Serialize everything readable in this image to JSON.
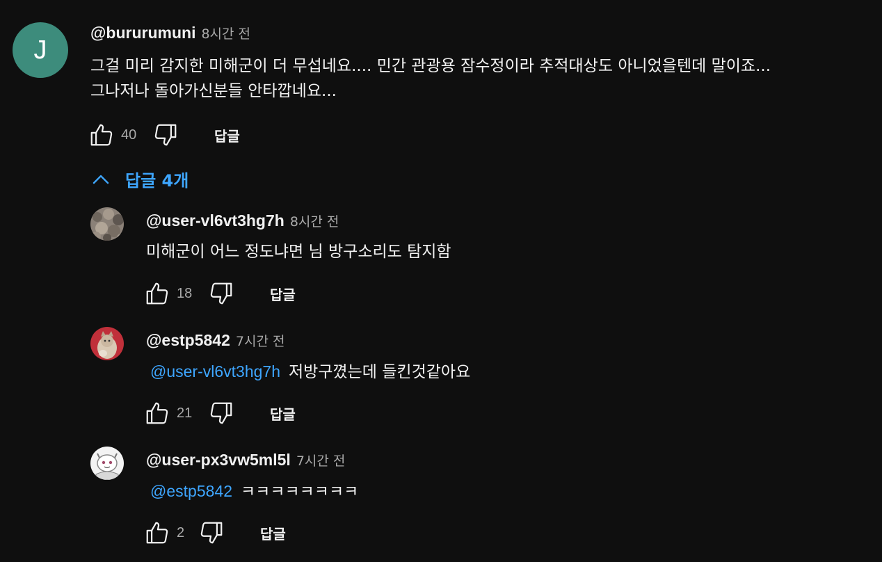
{
  "top_comment": {
    "avatar_letter": "J",
    "avatar_color": "#3d8c7c",
    "handle": "@bururumuni",
    "time": "8시간 전",
    "text_line1": "그걸 미리 감지한 미해군이 더 무섭네요.... 민간 관광용 잠수정이라 추적대상도 아니었을텐데 말이죠...",
    "text_line2": "그나저나 돌아가신분들 안타깝네요...",
    "likes": "40",
    "reply_label": "답글"
  },
  "replies_toggle": {
    "label": "답글 4개",
    "icon": "chevron-up-icon"
  },
  "replies": [
    {
      "handle": "@user-vl6vt3hg7h",
      "time": "8시간 전",
      "mention": "",
      "text": "미해군이 어느  정도냐면 님 방구소리도 탐지함",
      "likes": "18",
      "reply_label": "답글"
    },
    {
      "handle": "@estp5842",
      "time": "7시간 전",
      "mention": "@user-vl6vt3hg7h",
      "text": "저방구꼈는데 들킨것같아요",
      "likes": "21",
      "reply_label": "답글"
    },
    {
      "handle": "@user-px3vw5ml5l",
      "time": "7시간 전",
      "mention": "@estp5842",
      "text": "ㅋㅋㅋㅋㅋㅋㅋㅋ",
      "likes": "2",
      "reply_label": "답글"
    }
  ],
  "colors": {
    "background": "#0f0f0f",
    "link": "#3ea6ff",
    "secondary_text": "#aaaaaa"
  }
}
